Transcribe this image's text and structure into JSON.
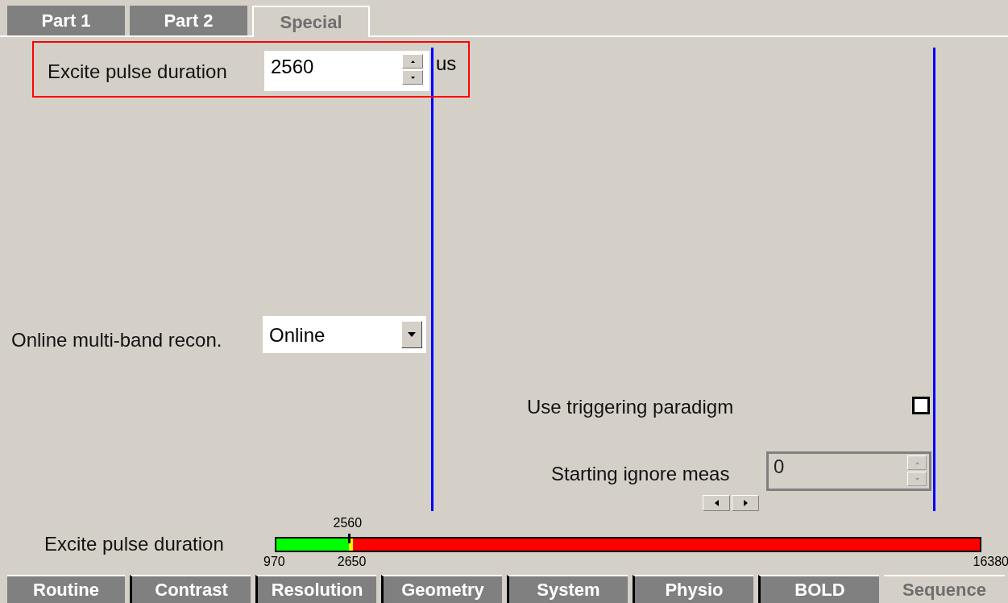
{
  "top_tabs": [
    {
      "label": "Part 1",
      "selected": false
    },
    {
      "label": "Part 2",
      "selected": false
    },
    {
      "label": "Special",
      "selected": true
    }
  ],
  "excite_pulse": {
    "label": "Excite pulse duration",
    "value": "2560",
    "unit": "us",
    "highlighted": true
  },
  "recon": {
    "label": "Online multi-band recon.",
    "value": "Online"
  },
  "triggering": {
    "label": "Use triggering paradigm",
    "checked": false
  },
  "ignore_meas": {
    "label": "Starting ignore meas",
    "value": "0",
    "disabled": true
  },
  "range_bar": {
    "label": "Excite pulse duration",
    "value_label": "2560",
    "min_label": "970",
    "limit_label": "2650",
    "max_label": "16380",
    "level": 0.103
  },
  "bottom_tabs": [
    {
      "label": "Routine",
      "selected": false
    },
    {
      "label": "Contrast",
      "selected": false
    },
    {
      "label": "Resolution",
      "selected": false
    },
    {
      "label": "Geometry",
      "selected": false
    },
    {
      "label": "System",
      "selected": false
    },
    {
      "label": "Physio",
      "selected": false
    },
    {
      "label": "BOLD",
      "selected": false
    },
    {
      "label": "Sequence",
      "selected": true
    }
  ]
}
